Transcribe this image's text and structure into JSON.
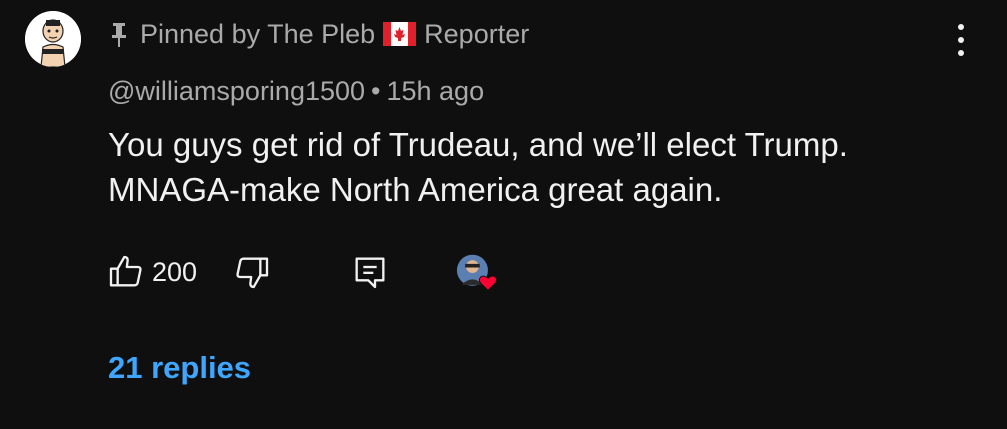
{
  "comment": {
    "pinned_label": "Pinned by The Pleb",
    "pinned_suffix": "Reporter",
    "author": "@williamsporing1500",
    "separator": "•",
    "time": "15h ago",
    "text_line1": "You guys get rid of Trudeau, and we’ll elect Trump.",
    "text_line2": "MNAGA-make North America great again.",
    "like_count": "200",
    "replies_label": "21 replies"
  },
  "icons": {
    "pin": "pin-icon",
    "flag": "canada-flag-icon",
    "more": "more-vertical-icon",
    "like": "thumbs-up-icon",
    "dislike": "thumbs-down-icon",
    "reply": "reply-icon",
    "heart": "heart-icon"
  },
  "colors": {
    "background": "#0f0f0f",
    "text": "#f1f1f1",
    "secondary": "#aaaaaa",
    "link": "#3ea6ff",
    "heart": "#ff0033"
  }
}
